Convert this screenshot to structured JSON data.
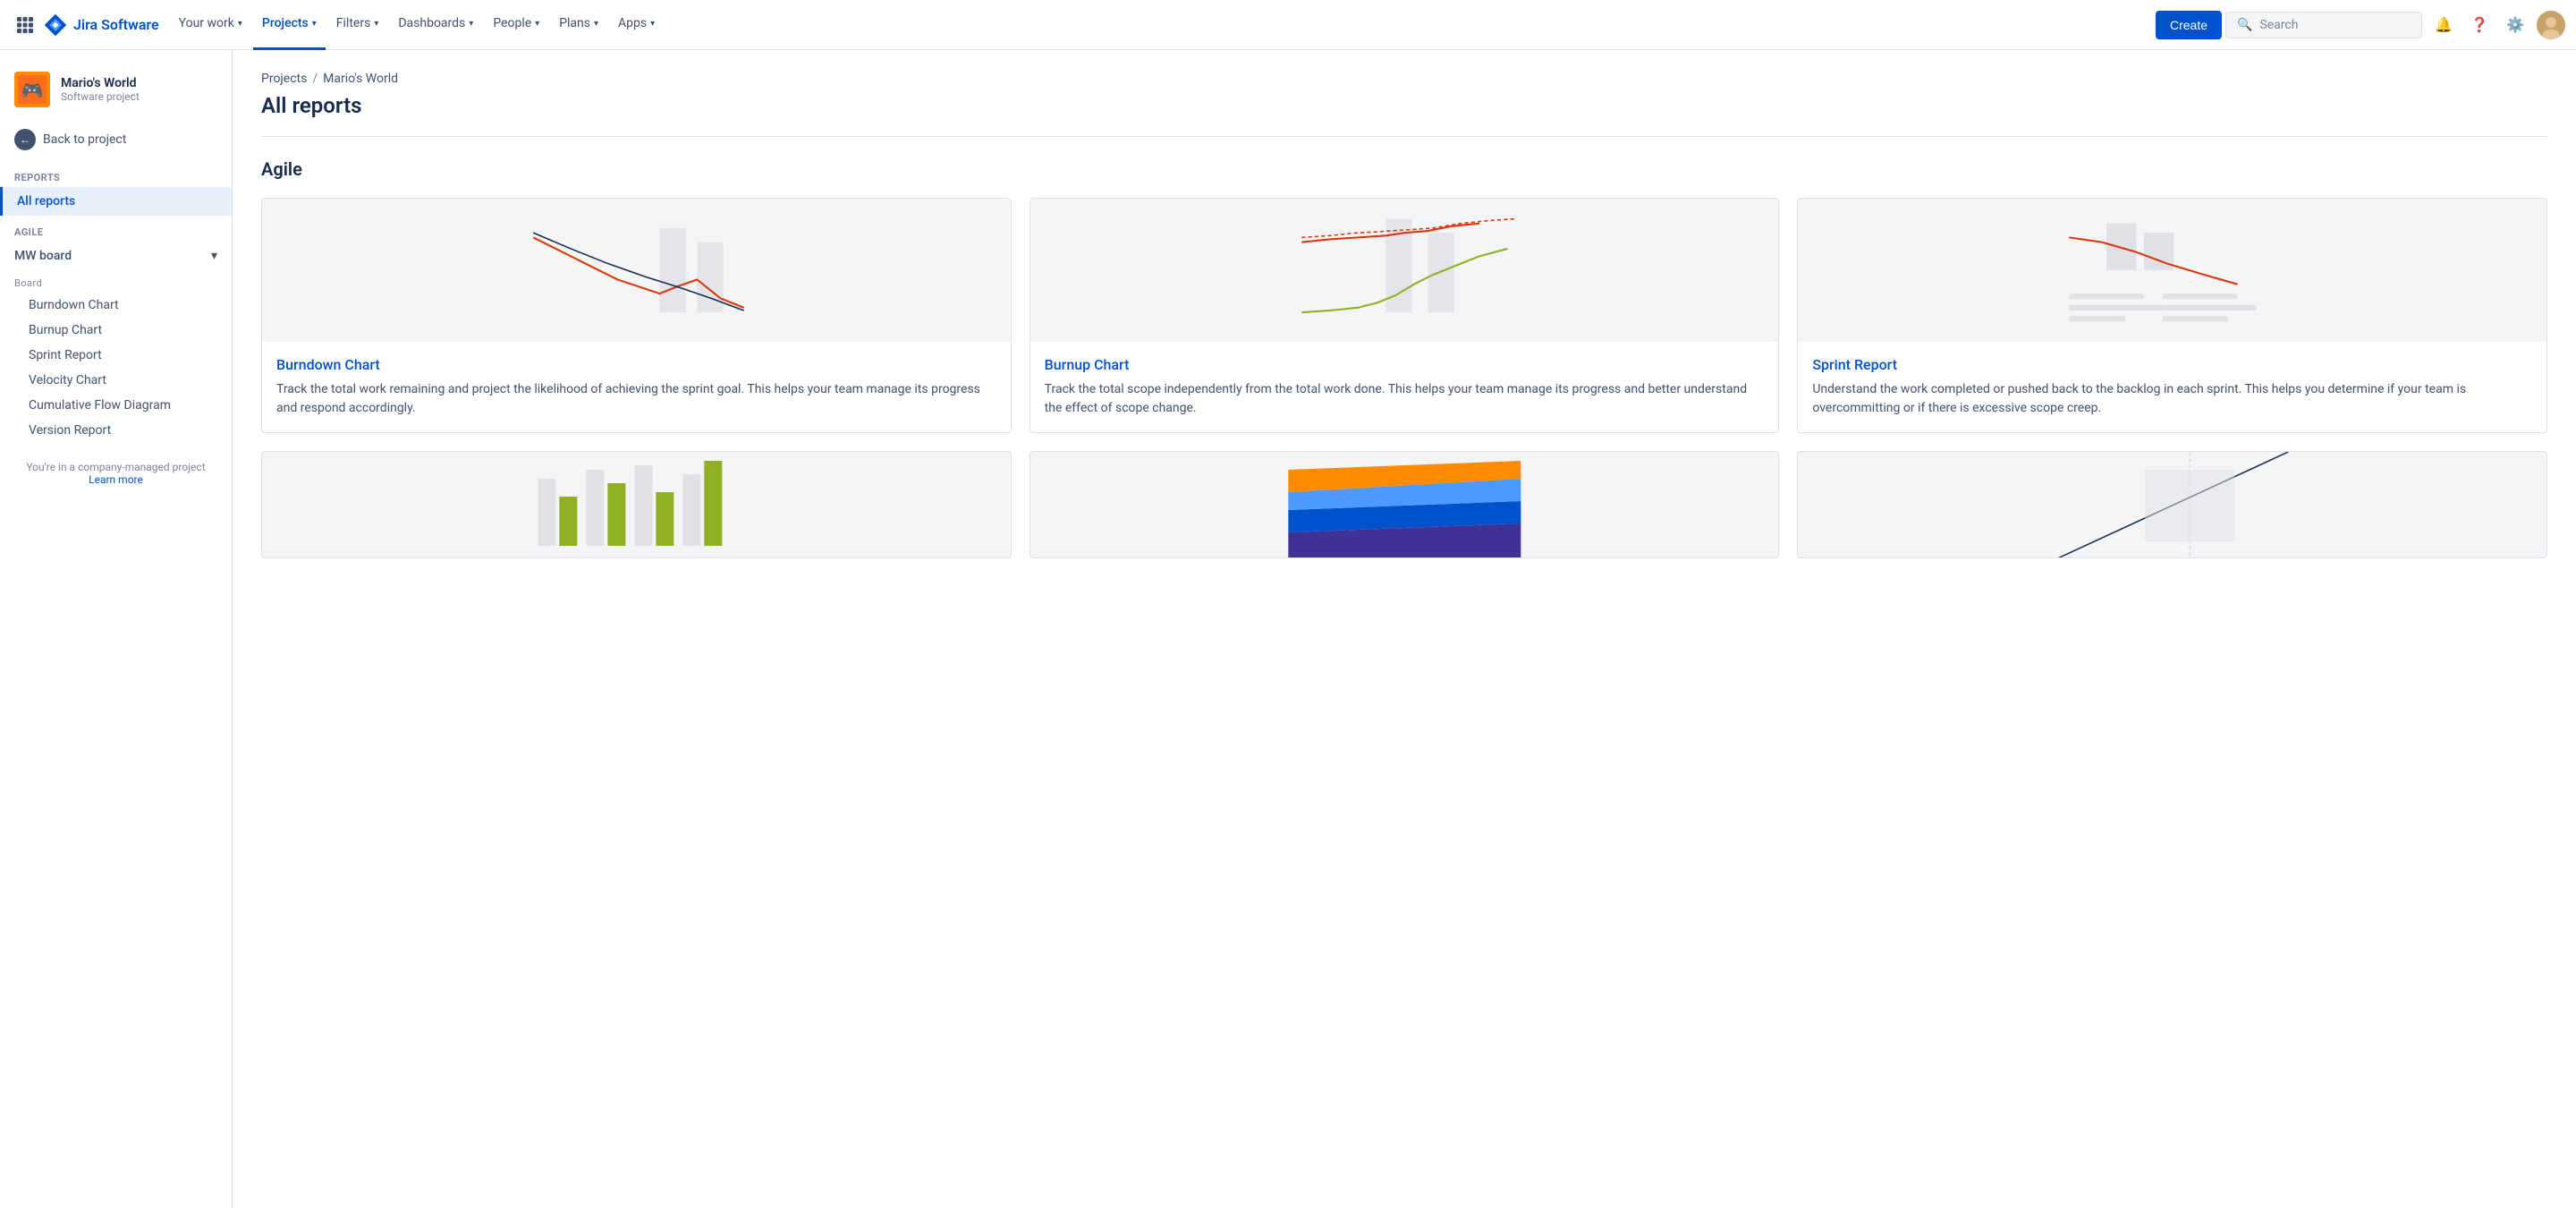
{
  "nav": {
    "logo_text": "Jira Software",
    "items": [
      {
        "label": "Your work",
        "id": "your-work",
        "active": false
      },
      {
        "label": "Projects",
        "id": "projects",
        "active": true
      },
      {
        "label": "Filters",
        "id": "filters",
        "active": false
      },
      {
        "label": "Dashboards",
        "id": "dashboards",
        "active": false
      },
      {
        "label": "People",
        "id": "people",
        "active": false
      },
      {
        "label": "Plans",
        "id": "plans",
        "active": false
      },
      {
        "label": "Apps",
        "id": "apps",
        "active": false
      }
    ],
    "create_label": "Create",
    "search_placeholder": "Search"
  },
  "sidebar": {
    "project_icon": "🎮",
    "project_name": "Mario's World",
    "project_type": "Software project",
    "back_label": "Back to project",
    "reports_heading": "Reports",
    "all_reports_label": "All reports",
    "agile_label": "AGILE",
    "board_name": "MW board",
    "board_type": "Board",
    "sub_items": [
      {
        "label": "Burndown Chart"
      },
      {
        "label": "Burnup Chart"
      },
      {
        "label": "Sprint Report"
      },
      {
        "label": "Velocity Chart"
      },
      {
        "label": "Cumulative Flow Diagram"
      },
      {
        "label": "Version Report"
      }
    ],
    "footer_text": "You're in a company-managed project",
    "footer_link": "Learn more"
  },
  "main": {
    "breadcrumb_projects": "Projects",
    "breadcrumb_mario": "Mario's World",
    "page_title": "All reports",
    "section_agile": "Agile",
    "cards": [
      {
        "id": "burndown",
        "title": "Burndown Chart",
        "desc": "Track the total work remaining and project the likelihood of achieving the sprint goal. This helps your team manage its progress and respond accordingly."
      },
      {
        "id": "burnup",
        "title": "Burnup Chart",
        "desc": "Track the total scope independently from the total work done. This helps your team manage its progress and better understand the effect of scope change."
      },
      {
        "id": "sprint",
        "title": "Sprint Report",
        "desc": "Understand the work completed or pushed back to the backlog in each sprint. This helps you determine if your team is overcommitting or if there is excessive scope creep."
      }
    ]
  }
}
